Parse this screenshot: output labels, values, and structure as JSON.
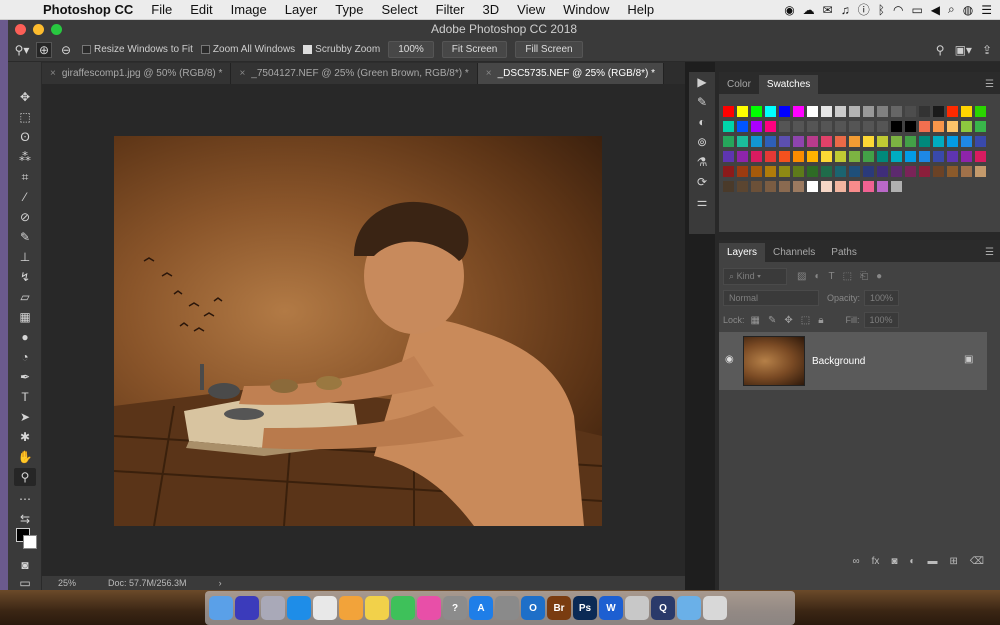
{
  "menubar": {
    "items": [
      "Photoshop CC",
      "File",
      "Edit",
      "Image",
      "Layer",
      "Type",
      "Select",
      "Filter",
      "3D",
      "View",
      "Window",
      "Help"
    ]
  },
  "titlebar": {
    "title": "Adobe Photoshop CC 2018"
  },
  "options": {
    "resize_windows": "Resize Windows to Fit",
    "zoom_all": "Zoom All Windows",
    "scrubby": "Scrubby Zoom",
    "zoom_value": "100%",
    "fit_screen": "Fit Screen",
    "fill_screen": "Fill Screen",
    "resize_checked": false,
    "zoom_all_checked": false,
    "scrubby_checked": true
  },
  "tabs": [
    {
      "label": "giraffescomp1.jpg @ 50% (RGB/8) *",
      "active": false
    },
    {
      "label": "_7504127.NEF @ 25% (Green Brown, RGB/8*) *",
      "active": false
    },
    {
      "label": "_DSC5735.NEF @ 25% (RGB/8*) *",
      "active": true
    }
  ],
  "status": {
    "zoom": "25%",
    "doc": "Doc: 57.7M/256.3M"
  },
  "color_panel": {
    "tabs": [
      "Color",
      "Swatches"
    ],
    "active": "Swatches"
  },
  "swatches": [
    [
      "#ff0000",
      "#ffff00",
      "#00ff00",
      "#00ffff",
      "#0000ff",
      "#ff00ff",
      "#ffffff",
      "#e6e6e6",
      "#cccccc",
      "#b3b3b3",
      "#999999",
      "#808080",
      "#666666",
      "#4d4d4d",
      "#333333",
      "#1a1a1a",
      "#ff2a00",
      "#ffd400",
      "#2bd400"
    ],
    [
      "#00d4aa",
      "#0055ff",
      "#aa00ff",
      "#ff0080",
      "#555555",
      "#555555",
      "#555555",
      "#555555",
      "#555555",
      "#555555",
      "#555555",
      "#555555",
      "#000000",
      "#000000",
      "#f26f4f",
      "#f7964a",
      "#fdc46a",
      "#8dc93f",
      "#39b54a"
    ],
    [
      "#26a65b",
      "#1bbc9b",
      "#1296d1",
      "#2e5fb8",
      "#5c4fb1",
      "#8e44ad",
      "#b83b8c",
      "#e04169",
      "#ea6a47",
      "#f39c33",
      "#fdd835",
      "#c0ca33",
      "#7cb342",
      "#43a047",
      "#00897b",
      "#00acc1",
      "#039be5",
      "#1e88e5",
      "#3949ab"
    ],
    [
      "#5e35b1",
      "#8e24aa",
      "#d81b60",
      "#e53935",
      "#f4511e",
      "#fb8c00",
      "#ffb300",
      "#fdd835",
      "#c0ca33",
      "#7cb342",
      "#43a047",
      "#00897b",
      "#00acc1",
      "#039be5",
      "#1e88e5",
      "#3949ab",
      "#5e35b1",
      "#8e24aa",
      "#d81b60"
    ],
    [
      "#8b1a1a",
      "#9c3b10",
      "#a65a0b",
      "#b07c0a",
      "#8d8a14",
      "#5e7a1a",
      "#2e6b25",
      "#1f6b4a",
      "#1b6470",
      "#1f4f7a",
      "#2a3a7a",
      "#3f2d7a",
      "#5c2a6e",
      "#7a2358",
      "#8b1e3b",
      "#6b4226",
      "#8b5a2b",
      "#a0714a",
      "#c49a6c"
    ],
    [
      "#4a3a2a",
      "#5b4530",
      "#6b5038",
      "#7a5c42",
      "#8a6a50",
      "#9b7a60",
      "#ffffff",
      "#f5d6c6",
      "#f2b5a0",
      "#f78b8b",
      "#f06292",
      "#ba68c8",
      "#b0b0b0"
    ]
  ],
  "layers_panel": {
    "tabs": [
      "Layers",
      "Channels",
      "Paths"
    ],
    "active": "Layers",
    "kind": "Kind",
    "blend": "Normal",
    "opacity_label": "Opacity:",
    "opacity_value": "100%",
    "lock_label": "Lock:",
    "fill_label": "Fill:",
    "fill_value": "100%",
    "layer_name": "Background"
  },
  "dock": {
    "apps": [
      "Finder",
      "Siri",
      "Launchpad",
      "Safari",
      "Chrome",
      "Photos",
      "Notes",
      "Messages",
      "iTunes",
      "Help",
      "App Store",
      "Prefs",
      "Outlook",
      "Br",
      "Ps",
      "Word",
      "Preview",
      "QuickTime",
      "Folder",
      "Trash"
    ]
  }
}
